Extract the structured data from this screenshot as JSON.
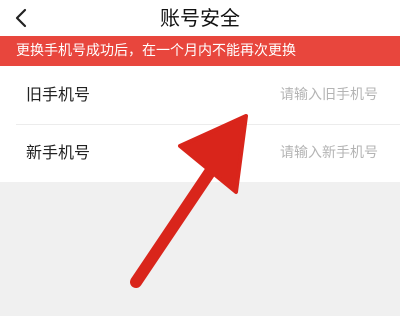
{
  "header": {
    "back_icon": "chevron-left-icon",
    "title": "账号安全"
  },
  "notice": {
    "text": "更换手机号成功后，在一个月内不能再次更换",
    "background": "#e8463d"
  },
  "form": {
    "old_phone": {
      "label": "旧手机号",
      "placeholder": "请输入旧手机号"
    },
    "new_phone": {
      "label": "新手机号",
      "placeholder": "请输入新手机号"
    }
  },
  "annotation": {
    "icon": "red-arrow-icon",
    "color": "#d9251b"
  }
}
